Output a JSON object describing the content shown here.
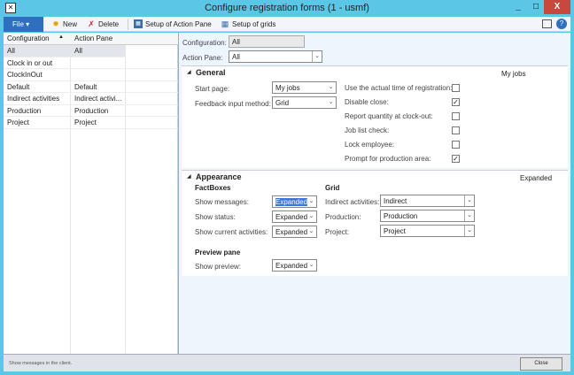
{
  "window": {
    "title": "Configure registration forms (1 - usmf)",
    "minimize": "_",
    "maximize": "□",
    "close": "X"
  },
  "toolbar": {
    "file": "File",
    "new": "New",
    "delete": "Delete",
    "setup_action_pane": "Setup of Action Pane",
    "setup_grids": "Setup of grids"
  },
  "list": {
    "headers": [
      "Configuration",
      "Action Pane"
    ],
    "sort_icon": "▲",
    "rows": [
      [
        "All",
        "All"
      ],
      [
        "Clock in or out",
        ""
      ],
      [
        "ClockInOut",
        ""
      ],
      [
        "Default",
        "Default"
      ],
      [
        "Indirect activities",
        "Indirect activi..."
      ],
      [
        "Production",
        "Production"
      ],
      [
        "Project",
        "Project"
      ]
    ]
  },
  "form": {
    "configuration_label": "Configuration:",
    "configuration_value": "All",
    "action_pane_label": "Action Pane:",
    "action_pane_value": "All",
    "general": {
      "title": "General",
      "summary": "My jobs",
      "start_page_label": "Start page:",
      "start_page_value": "My jobs",
      "feedback_label": "Feedback input method:",
      "feedback_value": "Grid",
      "checks": [
        {
          "label": "Use the actual time of registration:",
          "checked": false
        },
        {
          "label": "Disable close:",
          "checked": true
        },
        {
          "label": "Report quantity at clock-out:",
          "checked": false
        },
        {
          "label": "Job list check:",
          "checked": false
        },
        {
          "label": "Lock employee:",
          "checked": false
        },
        {
          "label": "Prompt for production area:",
          "checked": true
        }
      ]
    },
    "appearance": {
      "title": "Appearance",
      "summary": "Expanded",
      "factboxes": "FactBoxes",
      "grid": "Grid",
      "show_messages_label": "Show messages:",
      "show_messages_value": "Expanded",
      "show_status_label": "Show status:",
      "show_status_value": "Expanded",
      "show_current_label": "Show current activities:",
      "show_current_value": "Expanded",
      "indirect_label": "Indirect activities:",
      "indirect_value": "Indirect",
      "production_label": "Production:",
      "production_value": "Production",
      "project_label": "Project:",
      "project_value": "Project",
      "preview_pane": "Preview pane",
      "show_preview_label": "Show preview:",
      "show_preview_value": "Expanded"
    }
  },
  "status": {
    "message": "Show messages in the client.",
    "close": "Close"
  }
}
